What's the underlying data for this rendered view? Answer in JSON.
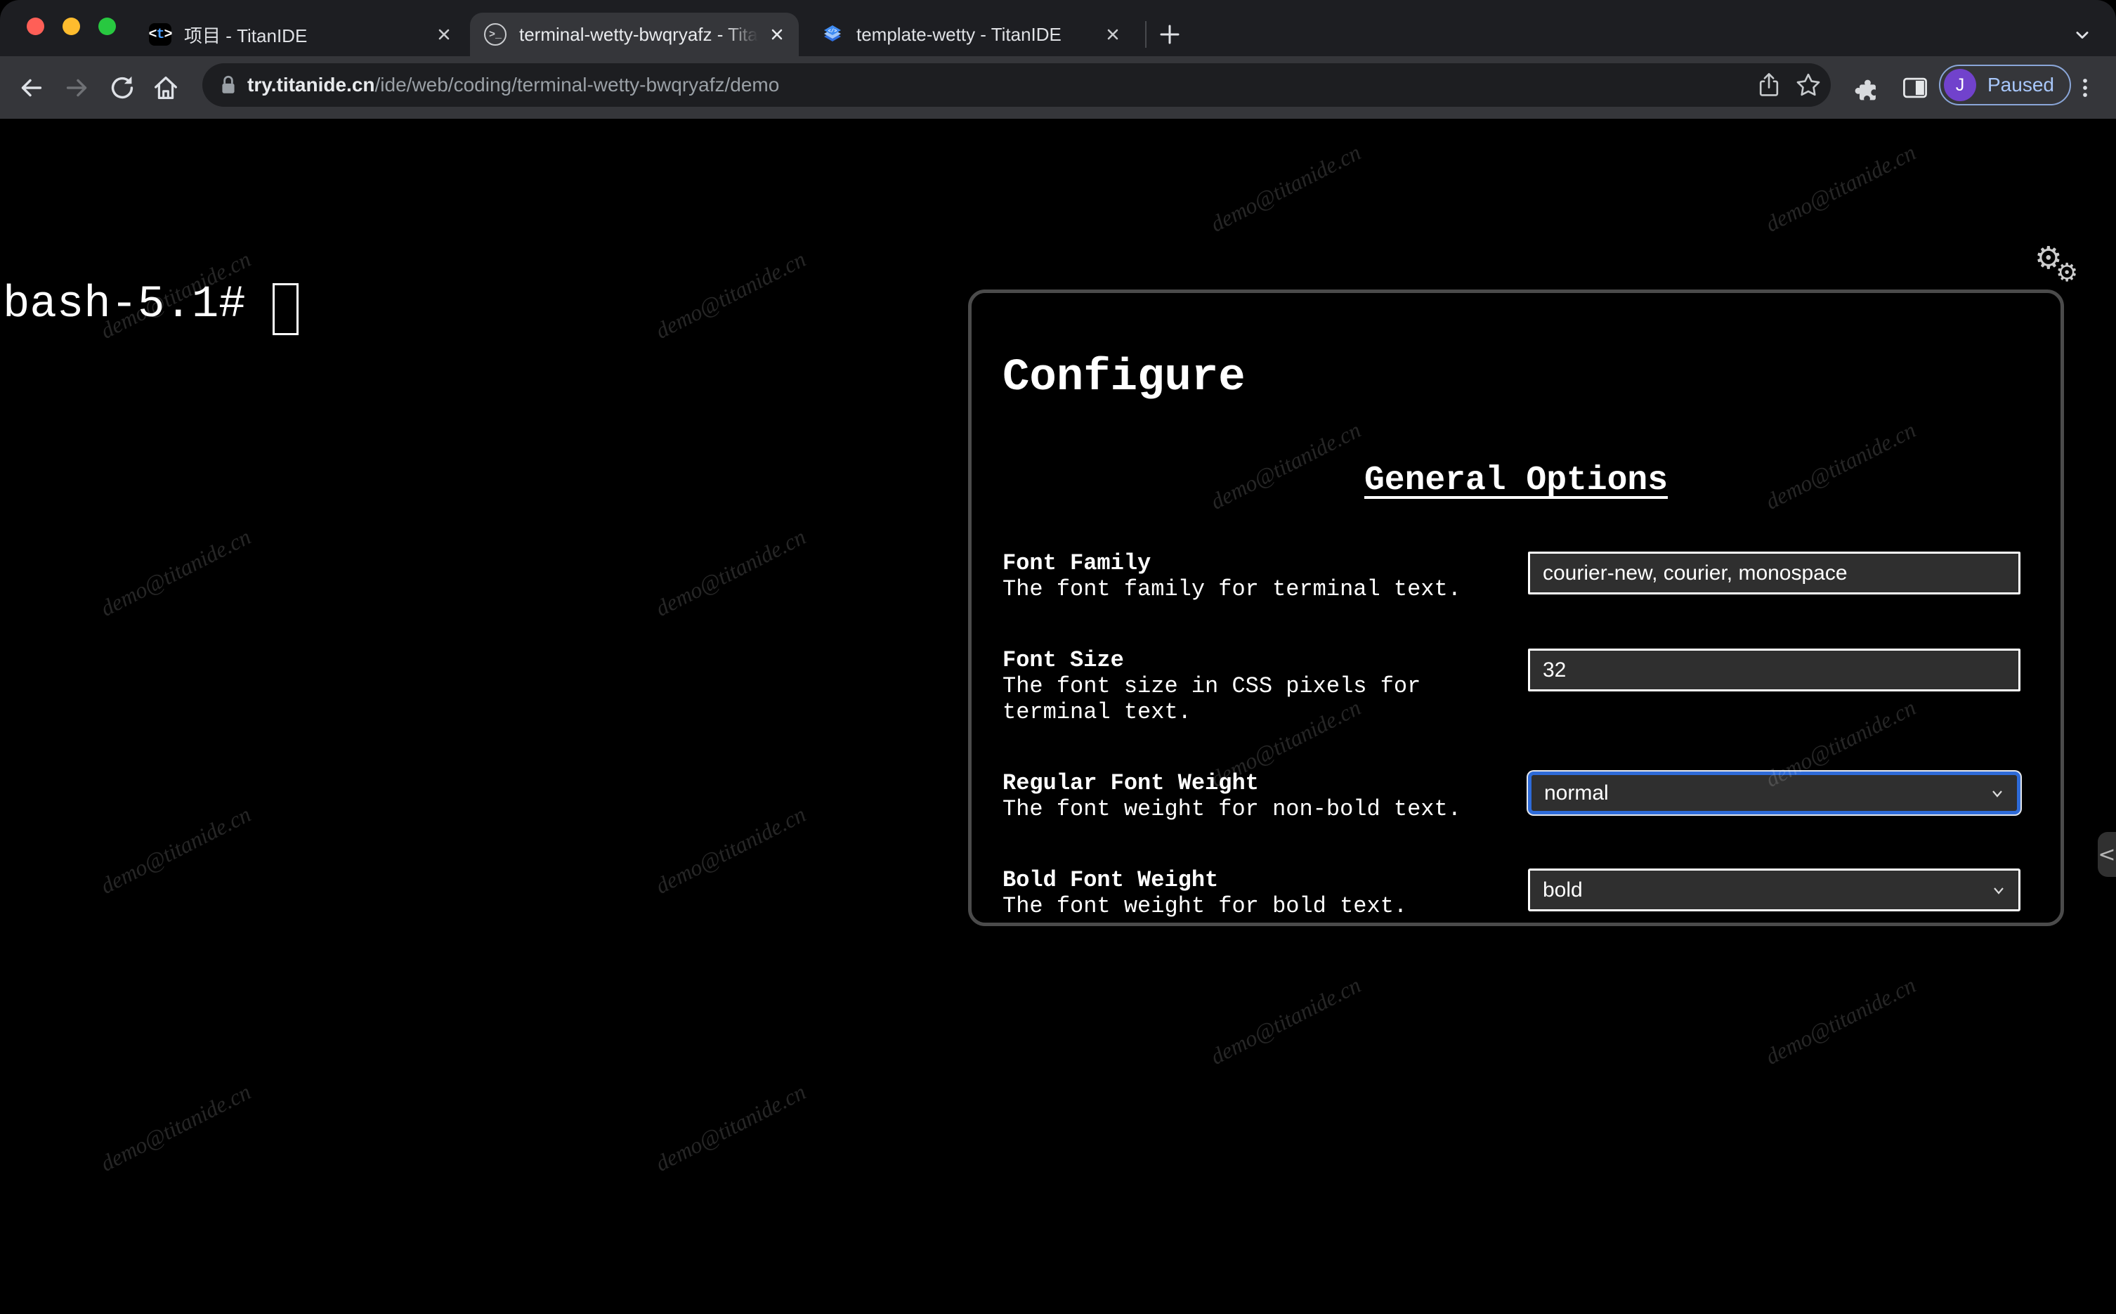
{
  "window": {
    "tabs": [
      {
        "title": "项目 - TitanIDE",
        "active": false,
        "icon": "titanide-favicon"
      },
      {
        "title": "terminal-wetty-bwqryafz - Tita",
        "active": true,
        "icon": "terminal-favicon"
      },
      {
        "title": "template-wetty - TitanIDE",
        "active": false,
        "icon": "layers-favicon"
      }
    ],
    "toolbar": {
      "url_domain": "try.titanide.cn",
      "url_path": "/ide/web/coding/terminal-wetty-bwqryafz/demo",
      "profile_initial": "J",
      "profile_label": "Paused"
    }
  },
  "terminal": {
    "prompt": "bash-5.1#",
    "terminal_icon_glyph": ">_",
    "titanide_icon_glyph": "<t>"
  },
  "watermark_text": "demo@titanide.cn",
  "config_panel": {
    "title": "Configure",
    "section_heading": "General Options",
    "fields": [
      {
        "label": "Font Family",
        "description": "The font family for terminal text.",
        "value": "courier-new, courier, monospace",
        "control": "input",
        "focused": false
      },
      {
        "label": "Font Size",
        "description": "The font size in CSS pixels for terminal text.",
        "value": "32",
        "control": "input",
        "focused": false
      },
      {
        "label": "Regular Font Weight",
        "description": "The font weight for non-bold text.",
        "value": "normal",
        "control": "select",
        "focused": true
      },
      {
        "label": "Bold Font Weight",
        "description": "The font weight for bold text.",
        "value": "bold",
        "control": "select",
        "focused": false
      }
    ]
  },
  "colors": {
    "accent_focus_blue": "#2e6bd9",
    "paused_text_blue": "#a8c7fa",
    "avatar_purple": "#7142cc",
    "favicon_blue": "#4a9eff",
    "layers_icon_blue": "#3f8cf3",
    "traffic_red": "#ff5f57",
    "traffic_yellow": "#febc2e",
    "traffic_green": "#28c840",
    "toolbar_bg": "#35363a",
    "tabstrip_bg": "#1d1e22",
    "terminal_bg": "#000000",
    "input_bg": "#2f2f2f",
    "panel_border": "#4b4b4b"
  }
}
